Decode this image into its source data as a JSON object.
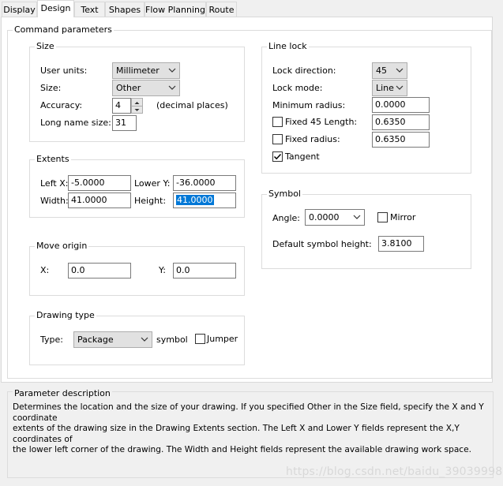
{
  "tabs": [
    "Display",
    "Design",
    "Text",
    "Shapes",
    "Flow Planning",
    "Route"
  ],
  "active_tab": "Design",
  "command_parameters": {
    "title": "Command parameters",
    "size": {
      "title": "Size",
      "user_units_label": "User units:",
      "user_units_value": "Millimeter",
      "size_label": "Size:",
      "size_value": "Other",
      "accuracy_label": "Accuracy:",
      "accuracy_value": "4",
      "accuracy_suffix": "(decimal places)",
      "long_name_label": "Long name size:",
      "long_name_value": "31"
    },
    "extents": {
      "title": "Extents",
      "left_x_label": "Left X:",
      "left_x_value": "-5.0000",
      "lower_y_label": "Lower Y:",
      "lower_y_value": "-36.0000",
      "width_label": "Width:",
      "width_value": "41.0000",
      "height_label": "Height:",
      "height_value": "41.0000"
    },
    "move_origin": {
      "title": "Move origin",
      "x_label": "X:",
      "x_value": "0.0",
      "y_label": "Y:",
      "y_value": "0.0"
    },
    "drawing_type": {
      "title": "Drawing type",
      "type_label": "Type:",
      "type_value": "Package",
      "symbol_label": "symbol",
      "jumper_label": "Jumper",
      "jumper_checked": false
    },
    "line_lock": {
      "title": "Line lock",
      "lock_direction_label": "Lock direction:",
      "lock_direction_value": "45",
      "lock_mode_label": "Lock mode:",
      "lock_mode_value": "Line",
      "min_radius_label": "Minimum radius:",
      "min_radius_value": "0.0000",
      "fixed45_label": "Fixed 45 Length:",
      "fixed45_value": "0.6350",
      "fixed45_checked": false,
      "fixed_radius_label": "Fixed radius:",
      "fixed_radius_value": "0.6350",
      "fixed_radius_checked": false,
      "tangent_label": "Tangent",
      "tangent_checked": true
    },
    "symbol": {
      "title": "Symbol",
      "angle_label": "Angle:",
      "angle_value": "0.0000",
      "mirror_label": "Mirror",
      "mirror_checked": false,
      "default_height_label": "Default symbol height:",
      "default_height_value": "3.8100"
    }
  },
  "parameter_description": {
    "title": "Parameter description",
    "lines": [
      "Determines the location and the size of your drawing.  If you specified Other in the Size field, specify the X and Y coordinate",
      "extents of the drawing size in the Drawing Extents section. The Left X and Lower Y fields represent the X,Y coordinates of",
      "the lower left corner of the drawing.  The Width and Height fields represent the available drawing work space."
    ]
  },
  "watermark": "https://blog.csdn.net/baidu_39039998"
}
